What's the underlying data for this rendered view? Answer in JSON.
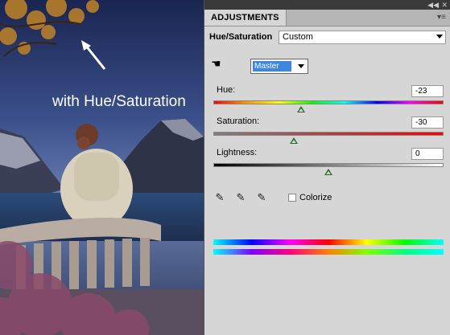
{
  "image": {
    "caption": "with Hue/Saturation"
  },
  "panel": {
    "tab_label": "ADJUSTMENTS",
    "title": "Hue/Saturation",
    "preset_value": "Custom",
    "channel_value": "Master",
    "hue": {
      "label": "Hue:",
      "value": "-23",
      "slider_fraction": 0.38
    },
    "saturation": {
      "label": "Saturation:",
      "value": "-30",
      "slider_fraction": 0.35
    },
    "lightness": {
      "label": "Lightness:",
      "value": "0",
      "slider_fraction": 0.5
    },
    "colorize_label": "Colorize",
    "colorize_checked": false
  },
  "icons": {
    "collapse": "double-arrow-icon",
    "close": "close-icon",
    "panel_menu": "panel-menu-icon",
    "on_image_adjust": "hand-adjust-icon",
    "eyedropper": "eyedropper-icon",
    "eyedropper_add": "eyedropper-plus-icon",
    "eyedropper_subtract": "eyedropper-minus-icon"
  }
}
